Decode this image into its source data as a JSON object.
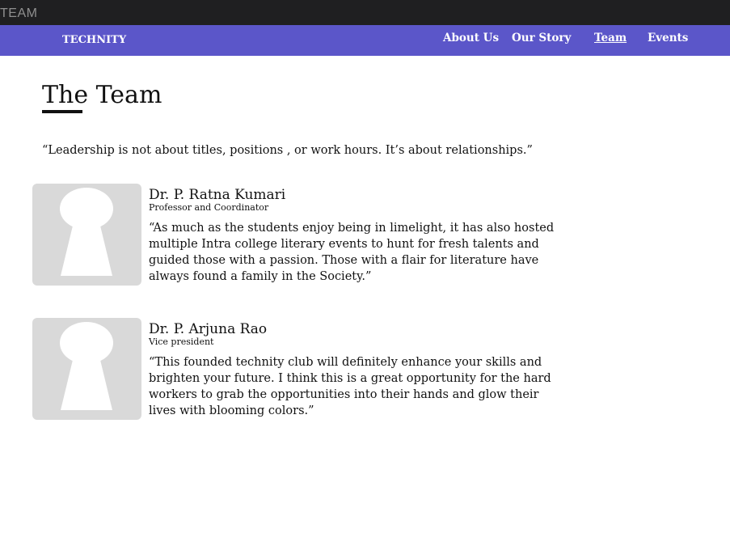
{
  "tab": {
    "title": "TEAM"
  },
  "navbar": {
    "brand": "TECHNITY",
    "links": [
      {
        "label": "About Us",
        "active": false
      },
      {
        "label": "Our Story",
        "active": false
      },
      {
        "label": "Team",
        "active": true
      },
      {
        "label": "Events",
        "active": false
      }
    ]
  },
  "page": {
    "title": "The Team",
    "quote": "“Leadership is not about titles, positions , or work hours. It’s about relationships.”"
  },
  "members": [
    {
      "name": "Dr. P. Ratna Kumari",
      "role": "Professor and Coordinator",
      "text": "“As much as the students enjoy being in limelight, it has also hosted multiple Intra college literary events to hunt for fresh talents and guided those with a passion. Those with a flair for literature have always found a family in the Society.”",
      "avatar_icon": "person-placeholder-icon"
    },
    {
      "name": "Dr. P. Arjuna Rao",
      "role": "Vice president",
      "text": "“This founded technity club will definitely enhance your skills and brighten your future. I think this is a great opportunity for the hard workers to grab the opportunities into their hands and glow their lives with blooming colors.”",
      "avatar_icon": "person-placeholder-icon"
    }
  ],
  "colors": {
    "tabbar": "#1f1f21",
    "navbar": "#5b56c9",
    "avatar_bg": "#d9d9d9"
  }
}
